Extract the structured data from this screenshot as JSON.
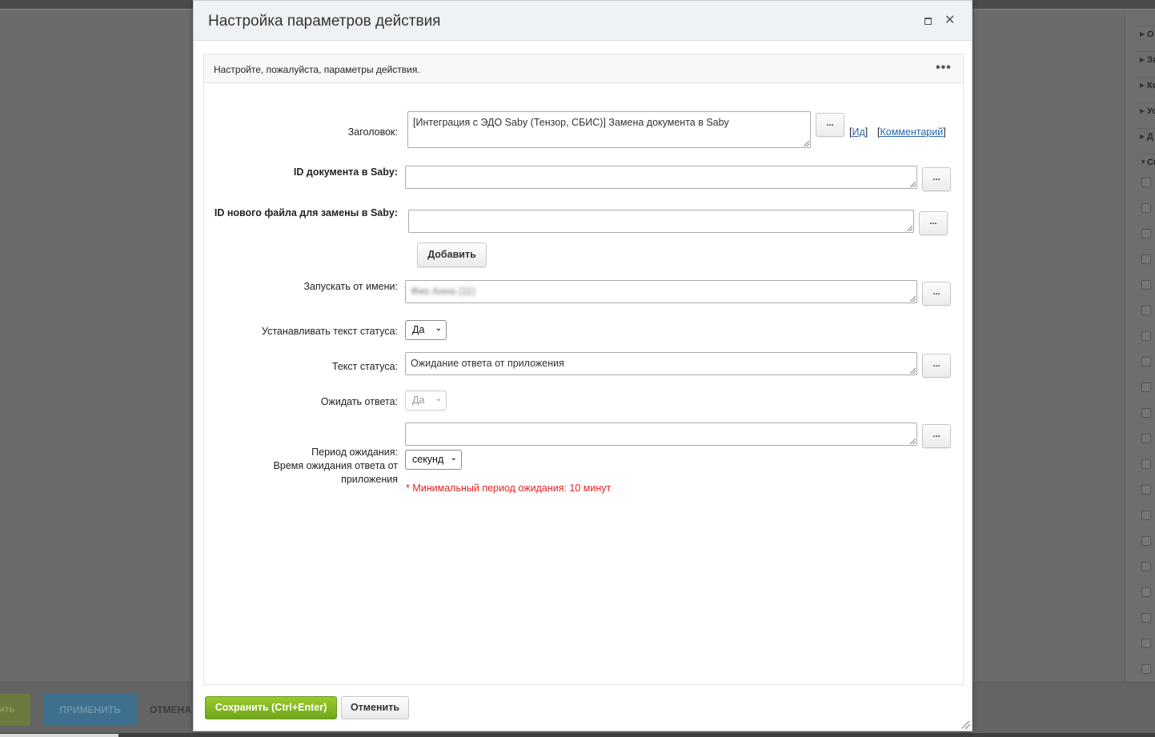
{
  "background": {
    "right_sidebar": [
      "О",
      "За",
      "Ко",
      "Ус",
      "Д",
      "Сп"
    ],
    "footer": {
      "save_partial": "ить",
      "apply_label": "ПРИМЕНИТЬ",
      "cancel_label": "ОТМЕНА"
    }
  },
  "dialog": {
    "title": "Настройка параметров действия",
    "intro": "Настройте, пожалуйста, параметры действия.",
    "more_icon": "•••",
    "close_icon": "✕",
    "dots": "...",
    "fields": {
      "title_label": "Заголовок:",
      "title_value": "[Интеграция с ЭДО Saby (Тензор, СБИС)] Замена документа в Saby",
      "id_link": "Ид",
      "comment_link": "Комментарий",
      "doc_id_label": "ID документа в Saby:",
      "doc_id_value": "",
      "new_file_label": "ID нового файла для замены в Saby:",
      "new_file_value": "",
      "add_button": "Добавить",
      "run_as_label": "Запускать от имени:",
      "run_as_value": "Фио Анна (11)",
      "set_status_label": "Устанавливать текст статуса:",
      "set_status_value": "Да",
      "status_text_label": "Текст статуса:",
      "status_text_value": "Ожидание ответа от приложения",
      "wait_label": "Ожидать ответа:",
      "wait_value": "Да",
      "period_label_1": "Период ожидания:",
      "period_label_2": "Время ожидания ответа от",
      "period_label_3": "приложения",
      "period_value": "",
      "period_unit": "секунд",
      "period_hint": "* Минимальный период ожидания: 10 минут"
    },
    "footer": {
      "save_label": "Сохранить (Ctrl+Enter)",
      "cancel_label": "Отменить"
    }
  },
  "colors": {
    "accent_green": "#7db320",
    "link_blue": "#2a67a8",
    "hint_red": "#e02424"
  }
}
